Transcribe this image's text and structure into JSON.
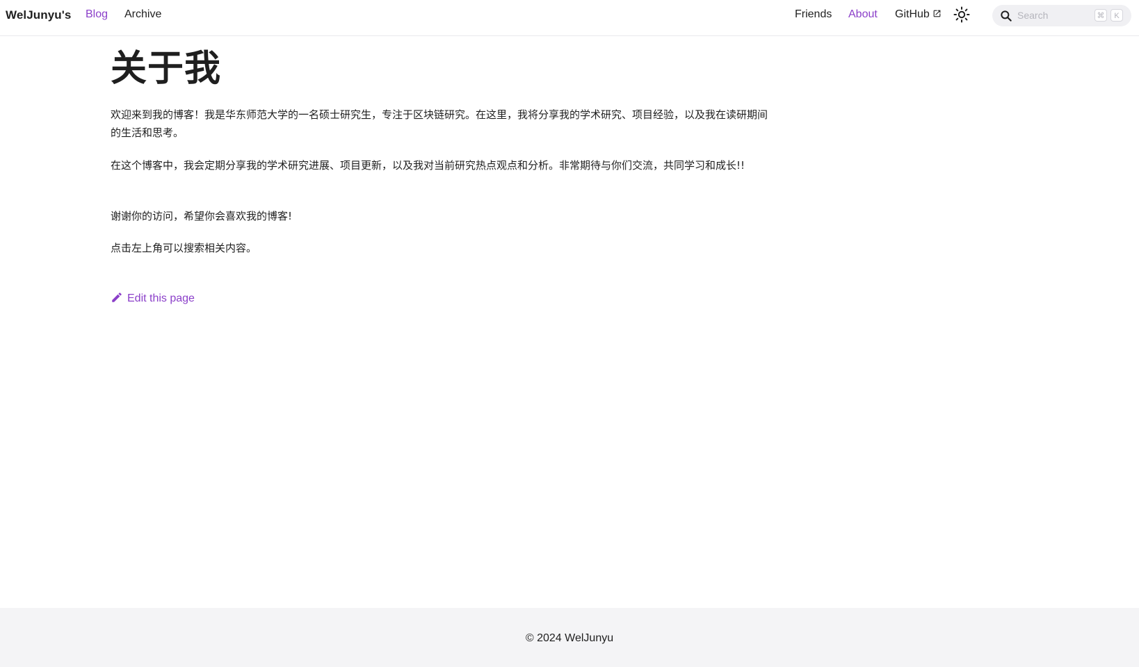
{
  "header": {
    "brand": "WelJunyu's",
    "nav_left": [
      {
        "label": "Blog",
        "active": true
      },
      {
        "label": "Archive",
        "active": false
      }
    ],
    "nav_right": [
      {
        "label": "Friends",
        "active": false
      },
      {
        "label": "About",
        "active": true
      },
      {
        "label": "GitHub",
        "active": false,
        "external": true
      }
    ],
    "theme_toggle_icon": "sun-icon",
    "search": {
      "placeholder": "Search",
      "value": "",
      "shortcut_keys": [
        "⌘",
        "K"
      ]
    }
  },
  "main": {
    "title": "关于我",
    "paragraphs": [
      "欢迎来到我的博客！我是华东师范大学的一名硕士研究生，专注于区块链研究。在这里，我将分享我的学术研究、项目经验，以及我在读研期间的生活和思考。",
      "在这个博客中，我会定期分享我的学术研究进展、项目更新，以及我对当前研究热点观点和分析。非常期待与你们交流，共同学习和成长!!",
      "谢谢你的访问，希望你会喜欢我的博客!",
      "点击左上角可以搜索相关内容。"
    ],
    "edit_link": "Edit this page"
  },
  "footer": {
    "copyright": "© 2024 WelJunyu"
  },
  "colors": {
    "accent": "#8b3fc9",
    "text": "#1f1f1f",
    "footer_bg": "#f4f4f6",
    "search_bg": "#f0f0f3"
  }
}
